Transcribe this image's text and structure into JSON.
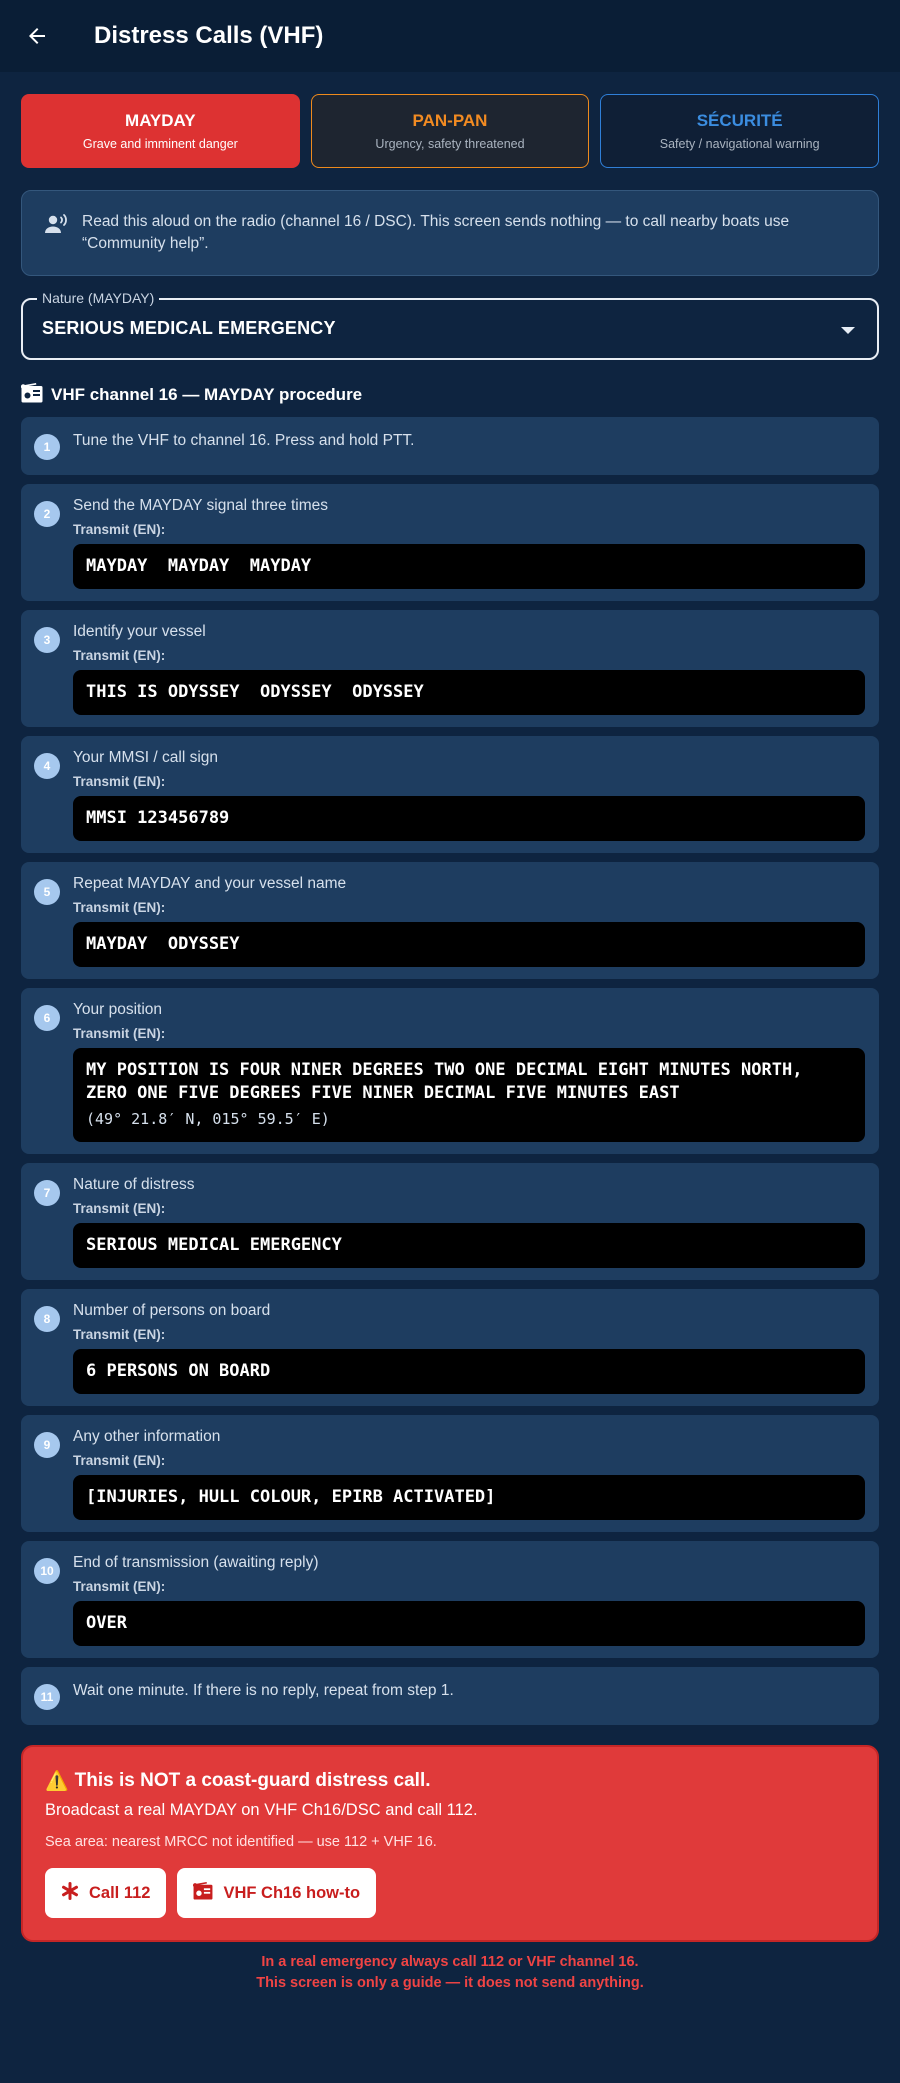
{
  "appbar": {
    "title": "Distress Calls (VHF)"
  },
  "segments": [
    {
      "label": "MAYDAY",
      "sub": "Grave and imminent danger"
    },
    {
      "label": "PAN-PAN",
      "sub": "Urgency, safety threatened"
    },
    {
      "label": "SÉCURITÉ",
      "sub": "Safety / navigational warning"
    }
  ],
  "info": {
    "text": "Read this aloud on the radio (channel 16 / DSC). This screen sends nothing — to call nearby boats use “Community help”."
  },
  "nature": {
    "label": "Nature (MAYDAY)",
    "value": "SERIOUS MEDICAL EMERGENCY"
  },
  "procedure": {
    "title": "VHF channel 16 — MAYDAY procedure",
    "transmit_label": "Transmit (EN):",
    "steps": [
      {
        "num": "1",
        "text": "Tune the VHF to channel 16. Press and hold PTT."
      },
      {
        "num": "2",
        "text": "Send the MAYDAY signal three times",
        "tx": "MAYDAY  MAYDAY  MAYDAY"
      },
      {
        "num": "3",
        "text": "Identify your vessel",
        "tx": "THIS IS ODYSSEY  ODYSSEY  ODYSSEY"
      },
      {
        "num": "4",
        "text": "Your MMSI / call sign",
        "tx": "MMSI 123456789"
      },
      {
        "num": "5",
        "text": "Repeat MAYDAY and your vessel name",
        "tx": "MAYDAY  ODYSSEY"
      },
      {
        "num": "6",
        "text": "Your position",
        "tx": "MY POSITION IS FOUR NINER DEGREES TWO ONE DECIMAL EIGHT MINUTES NORTH, ZERO ONE FIVE DEGREES FIVE NINER DECIMAL FIVE MINUTES EAST",
        "tx_sub": "(49° 21.8′ N, 015° 59.5′ E)"
      },
      {
        "num": "7",
        "text": "Nature of distress",
        "tx": "SERIOUS MEDICAL EMERGENCY"
      },
      {
        "num": "8",
        "text": "Number of persons on board",
        "tx": "6 PERSONS ON BOARD"
      },
      {
        "num": "9",
        "text": "Any other information",
        "tx": "[INJURIES, HULL COLOUR, EPIRB ACTIVATED]"
      },
      {
        "num": "10",
        "text": "End of transmission (awaiting reply)",
        "tx": "OVER"
      },
      {
        "num": "11",
        "text": "Wait one minute. If there is no reply, repeat from step 1."
      }
    ]
  },
  "alert": {
    "icon": "⚠️",
    "heading": "This is NOT a coast-guard distress call.",
    "body": "Broadcast a real MAYDAY on VHF Ch16/DSC and call 112.",
    "sea_area": "Sea area: nearest MRCC not identified — use 112 + VHF 16.",
    "call_label": "Call 112",
    "vhf_label": "VHF Ch16 how-to"
  },
  "footer": {
    "line1": "In a real emergency always call 112 or VHF channel 16.",
    "line2": "This screen is only a guide — it does not send anything."
  },
  "colors": {
    "mayday": "#dd3232",
    "panpan": "#f28b22",
    "securite": "#3b8de0",
    "background": "#0e2440",
    "card": "#1e3d60"
  }
}
